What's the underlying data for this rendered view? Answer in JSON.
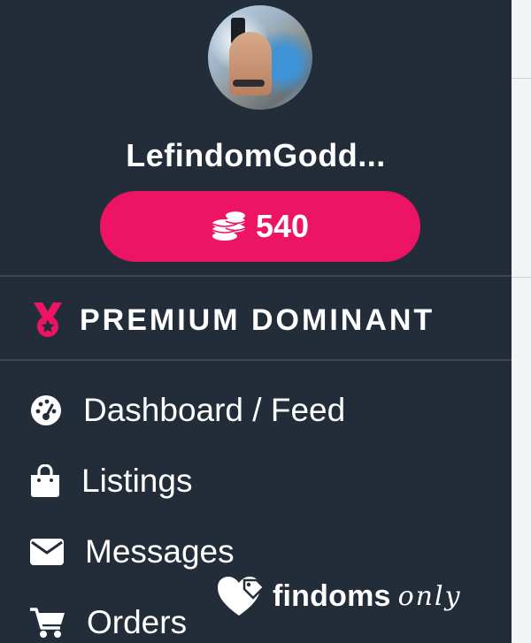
{
  "profile": {
    "username": "LefindomGodd...",
    "coins_value": "540"
  },
  "badge": {
    "label": "PREMIUM DOMINANT",
    "icon": "medal-icon"
  },
  "menu": {
    "items": [
      {
        "label": "Dashboard / Feed",
        "icon": "dashboard-icon"
      },
      {
        "label": "Listings",
        "icon": "shopping-bag-icon"
      },
      {
        "label": "Messages",
        "icon": "envelope-icon"
      },
      {
        "label": "Orders",
        "icon": "cart-icon"
      }
    ]
  },
  "watermark": {
    "brand_main": "findoms",
    "brand_script": "only"
  },
  "colors": {
    "sidebar_bg": "#232d3a",
    "accent": "#ee1464",
    "text": "#ffffff",
    "divider": "#3d4753"
  }
}
